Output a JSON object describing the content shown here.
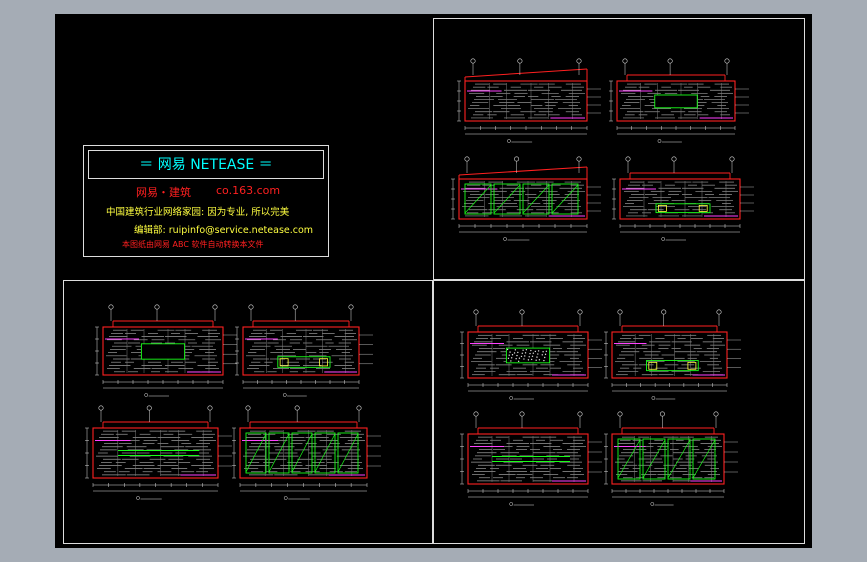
{
  "title_block": {
    "header": "＝ 网易  NETEASE ＝",
    "brand": "网易・建筑",
    "domain": "co.163.com",
    "slogan": "中国建筑行业网络家园: 因为专业, 所以完美",
    "editor": "编辑部: ruipinfo@service.netease.com",
    "note": "本图纸由网易 ABC 软件自动转换本文件"
  },
  "colors": {
    "background": "#000000",
    "outer": "#a5acb5",
    "frame": "#dddddd",
    "cyan": "#00ffff",
    "red": "#ff2020",
    "green": "#19ff19",
    "yellow": "#ffff40",
    "magenta": "#ff40ff"
  }
}
